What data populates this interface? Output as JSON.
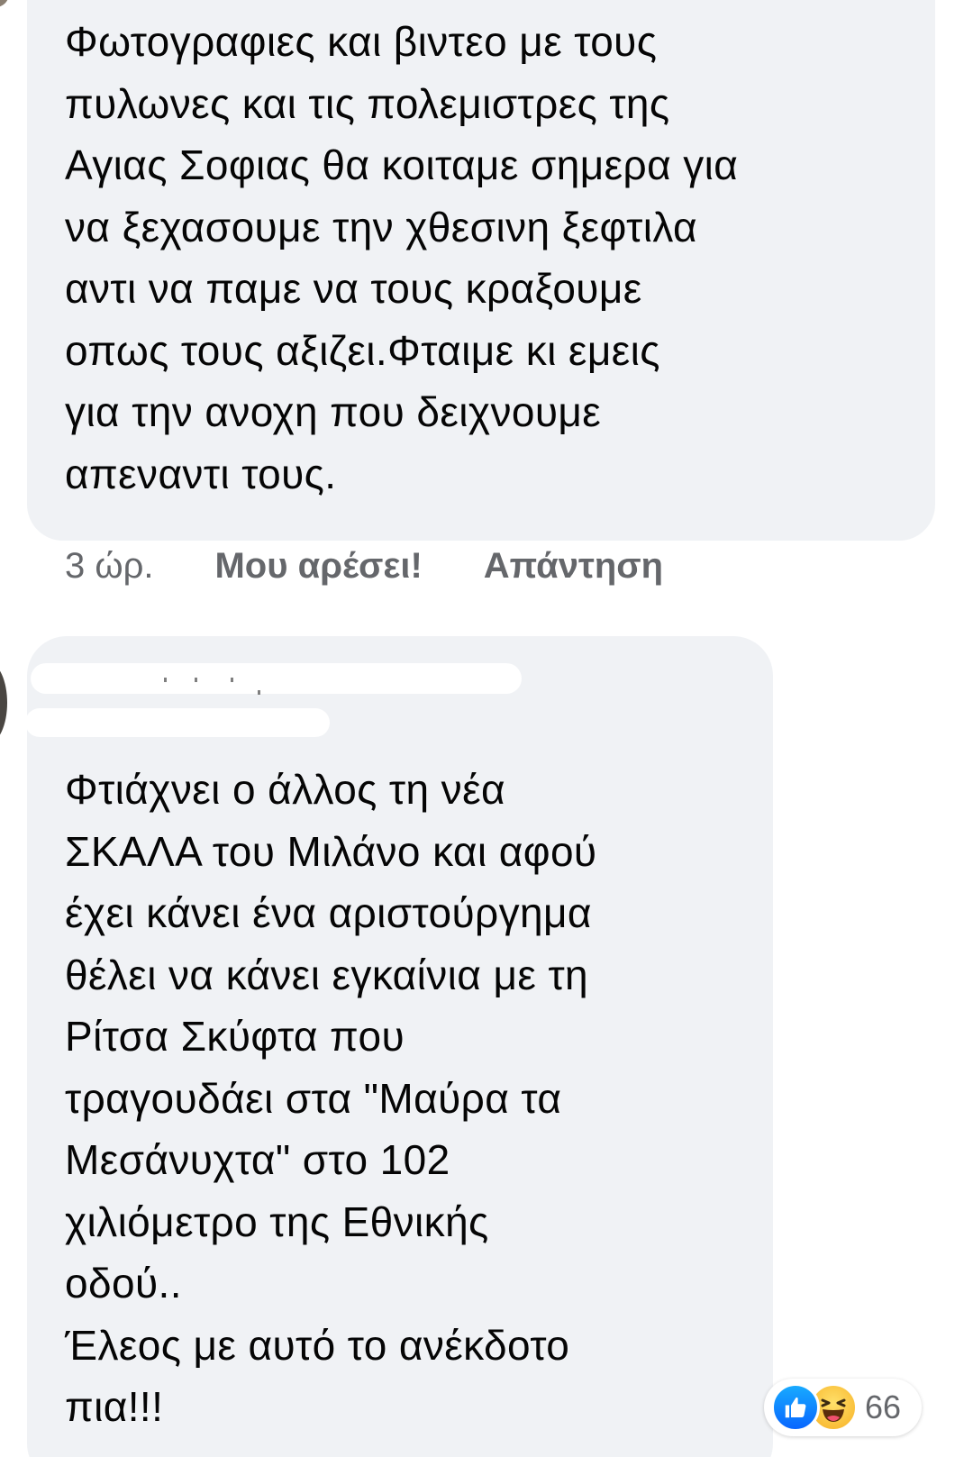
{
  "comments": [
    {
      "author": "",
      "text": "Φωτογραφιες και βιντεο με τους\nπυλωνες και τις πολεμιστρες της\nΑγιας Σοφιας θα κοιταμε σημερα για\nνα ξεχασουμε την χθεσινη ξεφτιλα\nαντι να παμε να τους κραξουμε\nοπως τους αξιζει.Φταιμε κι εμεις\nγια την ανοχη που δειχνουμε\nαπεναντι τους.",
      "time": "3 ώρ.",
      "like_label": "Μου αρέσει!",
      "reply_label": "Απάντηση"
    },
    {
      "author": "",
      "text": "Φτιάχνει ο άλλος τη νέα\nΣΚΑΛΑ του Μιλάνο και αφού\nέχει κάνει ένα αριστούργημα\nθέλει να κάνει εγκαίνια με τη\nΡίτσα Σκύφτα που\nτραγουδάει στα \"Μαύρα τα\nΜεσάνυχτα\" στο 102\nχιλιόμετρο της Εθνικής\nοδού..\nΈλεος με αυτό το ανέκδοτο\nπια!!!",
      "reactions": {
        "icons": [
          "like-icon",
          "haha-icon"
        ],
        "count": "66"
      }
    }
  ],
  "colors": {
    "bubble": "#f0f2f5",
    "text": "#050505",
    "secondary": "#65676b",
    "like_blue": "#0866ff",
    "haha_yellow": "#f7b125"
  }
}
